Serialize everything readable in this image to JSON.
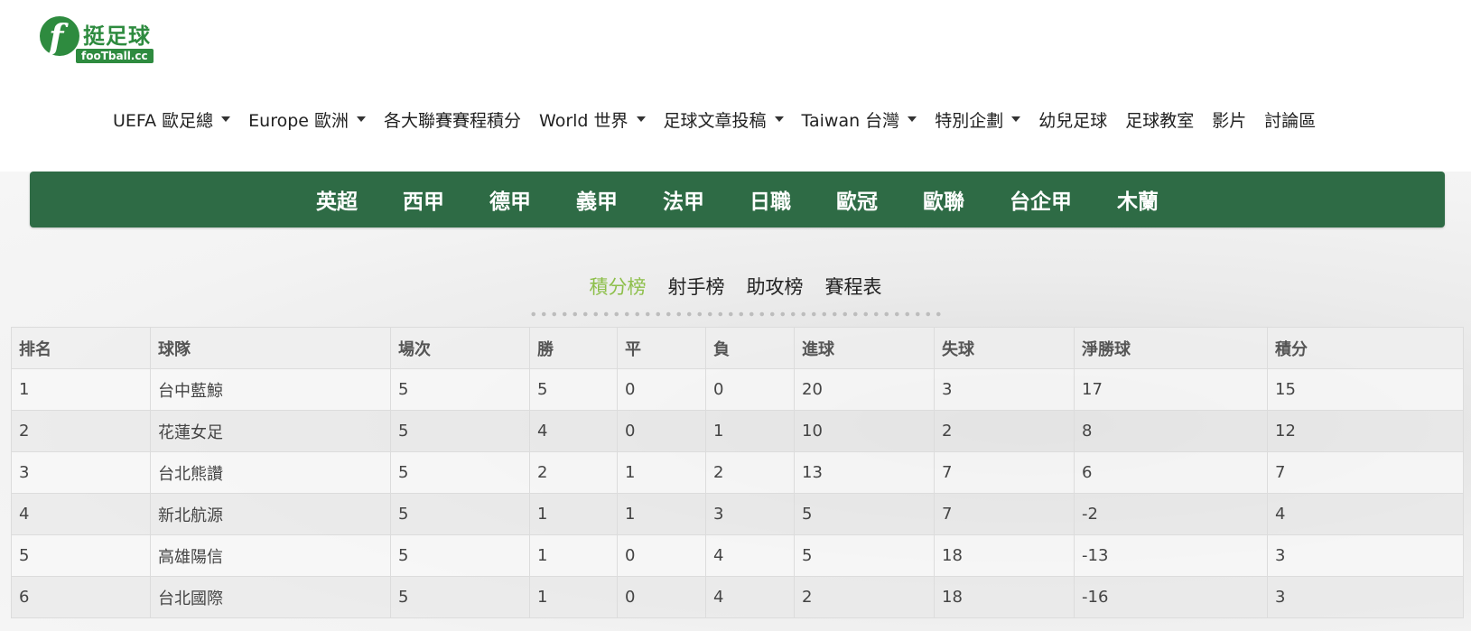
{
  "logo": {
    "cn": "挺足球",
    "en": "fooTball.cc",
    "initial": "f"
  },
  "nav": [
    {
      "label": "UEFA 歐足總",
      "caret": true
    },
    {
      "label": "Europe 歐洲",
      "caret": true
    },
    {
      "label": "各大聯賽賽程積分",
      "caret": false
    },
    {
      "label": "World 世界",
      "caret": true
    },
    {
      "label": "足球文章投稿",
      "caret": true
    },
    {
      "label": "Taiwan 台灣",
      "caret": true
    },
    {
      "label": "特別企劃",
      "caret": true
    },
    {
      "label": "幼兒足球",
      "caret": false
    },
    {
      "label": "足球教室",
      "caret": false
    },
    {
      "label": "影片",
      "caret": false
    },
    {
      "label": "討論區",
      "caret": false
    }
  ],
  "leagues": [
    "英超",
    "西甲",
    "德甲",
    "義甲",
    "法甲",
    "日職",
    "歐冠",
    "歐聯",
    "台企甲",
    "木蘭"
  ],
  "subtabs": [
    {
      "label": "積分榜",
      "active": true
    },
    {
      "label": "射手榜",
      "active": false
    },
    {
      "label": "助攻榜",
      "active": false
    },
    {
      "label": "賽程表",
      "active": false
    }
  ],
  "table": {
    "headers": [
      "排名",
      "球隊",
      "場次",
      "勝",
      "平",
      "負",
      "進球",
      "失球",
      "淨勝球",
      "積分"
    ],
    "rows": [
      [
        "1",
        "台中藍鯨",
        "5",
        "5",
        "0",
        "0",
        "20",
        "3",
        "17",
        "15"
      ],
      [
        "2",
        "花蓮女足",
        "5",
        "4",
        "0",
        "1",
        "10",
        "2",
        "8",
        "12"
      ],
      [
        "3",
        "台北熊讚",
        "5",
        "2",
        "1",
        "2",
        "13",
        "7",
        "6",
        "7"
      ],
      [
        "4",
        "新北航源",
        "5",
        "1",
        "1",
        "3",
        "5",
        "7",
        "-2",
        "4"
      ],
      [
        "5",
        "高雄陽信",
        "5",
        "1",
        "0",
        "4",
        "5",
        "18",
        "-13",
        "3"
      ],
      [
        "6",
        "台北國際",
        "5",
        "1",
        "0",
        "4",
        "2",
        "18",
        "-16",
        "3"
      ]
    ]
  },
  "colors": {
    "brand_green": "#2e8b3f",
    "league_bar": "#2e6b45",
    "active_tab": "#8dbf4a"
  }
}
